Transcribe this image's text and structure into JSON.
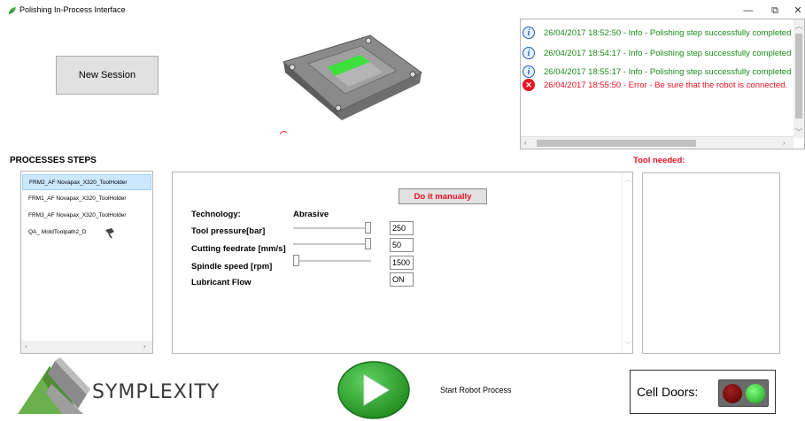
{
  "window": {
    "title": "Polishing In-Process Interface",
    "icon": "leaf-app-icon",
    "minimize_glyph": "—",
    "restore_glyph": "⧉",
    "close_glyph": "✕"
  },
  "session": {
    "new_session_label": "New Session"
  },
  "log": {
    "entries": [
      {
        "level": "info",
        "icon": "info-icon",
        "text": "26/04/2017 18:52:50 - Info - Polishing step successfully completed"
      },
      {
        "level": "info",
        "icon": "info-icon",
        "text": "26/04/2017 18:54:17 - Info - Polishing step successfully completed"
      },
      {
        "level": "info",
        "icon": "info-icon",
        "text": "26/04/2017 18:55:17 - Info - Polishing step successfully completed"
      },
      {
        "level": "error",
        "icon": "error-icon",
        "text": "26/04/2017 18:55:50 - Error -  Be sure that the robot is connected."
      }
    ]
  },
  "processes": {
    "title": "PROCESSES STEPS",
    "steps": [
      {
        "label": "FRM2_AF Novapax_X320_ToolHolder",
        "selected": true
      },
      {
        "label": "FRM1_AF Novapax_X320_ToolHolder",
        "selected": false
      },
      {
        "label": "FRM3_AF Novapax_X320_ToolHolder",
        "selected": false
      },
      {
        "label": "QA_ MoldToolpath2_D",
        "selected": false,
        "icon": "scanner-tool-icon"
      }
    ]
  },
  "parameters": {
    "manual_button": "Do it manually",
    "technology_label": "Technology:",
    "technology_value": "Abrasive",
    "tool_pressure_label": "Tool pressure[bar]",
    "tool_pressure_value": "250",
    "tool_pressure_level": 1.0,
    "cutting_feedrate_label": "Cutting feedrate [mm/s]",
    "cutting_feedrate_value": "50",
    "cutting_feedrate_level": 1.0,
    "spindle_speed_label": "Spindle speed [rpm]",
    "spindle_speed_value": "1500",
    "spindle_speed_level": 0.0,
    "lubricant_label": "Lubricant Flow",
    "lubricant_value": "ON"
  },
  "tool": {
    "title": "Tool needed:"
  },
  "footer": {
    "logo_text": "SYMPLEXITY",
    "start_label": "Start Robot Process",
    "doors_label": "Cell Doors:",
    "doors_red_on": false,
    "doors_green_on": true
  },
  "colors": {
    "info_text": "#1a8b1a",
    "error_text": "#e81123",
    "selection": "#cce8ff",
    "play_green": "#2db02d",
    "logo_green": "#6ab04c"
  }
}
